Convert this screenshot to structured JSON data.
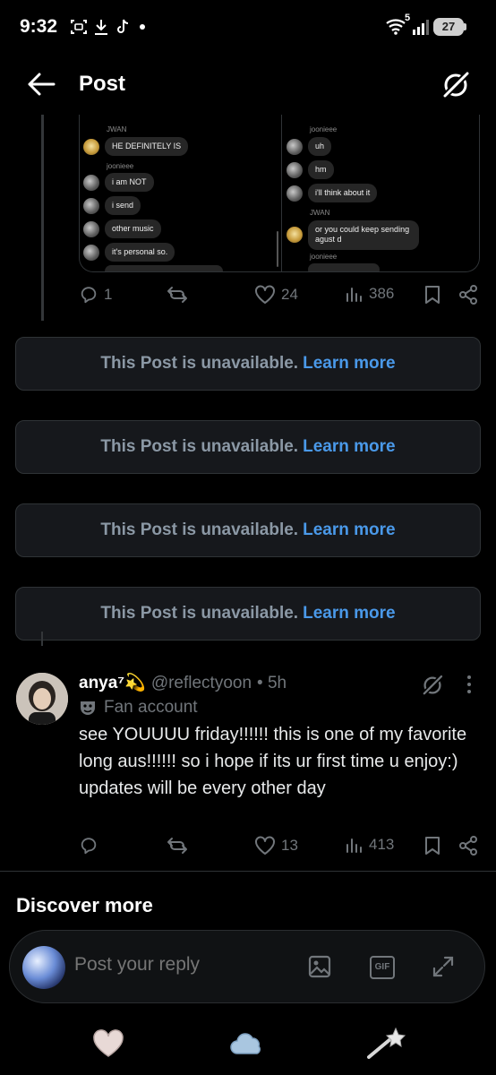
{
  "status": {
    "time": "9:32",
    "battery": "27",
    "network": "5"
  },
  "header": {
    "title": "Post"
  },
  "media": {
    "left": [
      {
        "type": "name",
        "text": "JWAN"
      },
      {
        "type": "msg",
        "avatar": "yellow",
        "text": "HE DEFINITELY IS"
      },
      {
        "type": "name",
        "text": "joonieee"
      },
      {
        "type": "msg",
        "avatar": "grey",
        "text": "i am NOT"
      },
      {
        "type": "msg",
        "avatar": "grey",
        "text": "i send"
      },
      {
        "type": "msg",
        "avatar": "grey",
        "text": "other music"
      },
      {
        "type": "msg",
        "avatar": "grey",
        "text": "it's personal so."
      }
    ],
    "right": [
      {
        "type": "name",
        "text": "joonieee"
      },
      {
        "type": "msg",
        "avatar": "grey",
        "text": "uh"
      },
      {
        "type": "msg",
        "avatar": "grey",
        "text": "hm"
      },
      {
        "type": "msg",
        "avatar": "grey",
        "text": "i'll think about it"
      },
      {
        "type": "name",
        "text": "JWAN"
      },
      {
        "type": "msg",
        "avatar": "yellow",
        "text": "or you could keep sending agust d"
      },
      {
        "type": "name",
        "text": "joonieee"
      }
    ]
  },
  "post1_actions": {
    "replies": "1",
    "likes": "24",
    "views": "386"
  },
  "unavailable": [
    {
      "text": "This Post is unavailable.",
      "link": "Learn more"
    },
    {
      "text": "This Post is unavailable.",
      "link": "Learn more"
    },
    {
      "text": "This Post is unavailable.",
      "link": "Learn more"
    },
    {
      "text": "This Post is unavailable.",
      "link": "Learn more"
    }
  ],
  "reply_post": {
    "name": "anya⁷💫",
    "handle": "@reflectyoon",
    "time": "• 5h",
    "badge": "Fan account",
    "text": "see YOUUUU friday!!!!!! this is one of my favorite long aus!!!!!! so i hope if its ur first time u enjoy:) updates will be every other day",
    "replies": "",
    "likes": "13",
    "views": "413"
  },
  "discover": "Discover more",
  "composer": {
    "placeholder": "Post your reply",
    "gif": "GIF"
  },
  "colors": {
    "background": "#000000",
    "link": "#4a99e9",
    "muted": "#71767b",
    "card": "#16181c"
  }
}
